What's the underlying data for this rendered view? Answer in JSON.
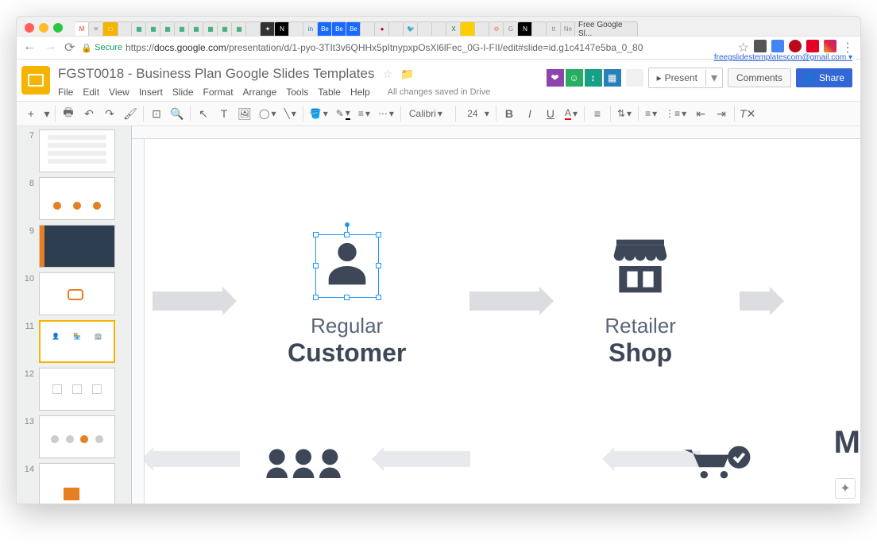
{
  "browser": {
    "last_tab_title": "Free Google Sl...",
    "secure_label": "Secure",
    "url_prefix": "https://",
    "url_host": "docs.google.com",
    "url_path": "/presentation/d/1-pyo-3TIt3v6QHHx5pItnypxpOsXl6lFec_0G-I-FII/edit#slide=id.g1c4147e5ba_0_80"
  },
  "header": {
    "doc_title": "FGST0018 - Business Plan Google Slides Templates",
    "user_email": "freegslidestemplatescom@gmail.com",
    "menu": {
      "file": "File",
      "edit": "Edit",
      "view": "View",
      "insert": "Insert",
      "slide": "Slide",
      "format": "Format",
      "arrange": "Arrange",
      "tools": "Tools",
      "table": "Table",
      "help": "Help",
      "saved": "All changes saved in Drive"
    },
    "buttons": {
      "present": "Present",
      "comments": "Comments",
      "share": "Share"
    }
  },
  "toolbar": {
    "font_name": "Calibri",
    "font_size": "24"
  },
  "thumbnails": {
    "slides": [
      "7",
      "8",
      "9",
      "10",
      "11",
      "12",
      "13",
      "14"
    ],
    "selected_index": 4
  },
  "slide": {
    "item1": {
      "line1": "Regular",
      "line2": "Customer"
    },
    "item2": {
      "line1": "Retailer",
      "line2": "Shop"
    },
    "cutoff_letter": "M"
  }
}
